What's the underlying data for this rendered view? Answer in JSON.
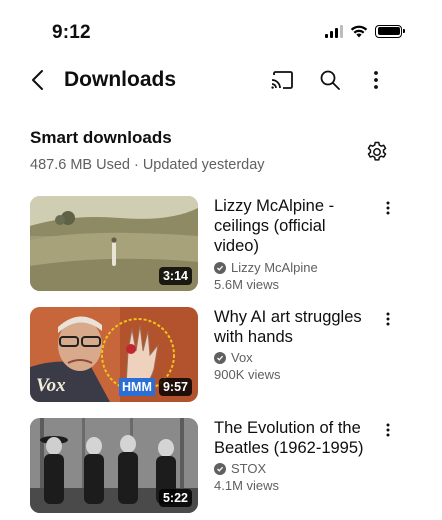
{
  "status_bar": {
    "time": "9:12"
  },
  "header": {
    "title": "Downloads",
    "icons": [
      "back-arrow-icon",
      "cast-icon",
      "search-icon",
      "more-vertical-icon"
    ]
  },
  "smart_downloads": {
    "title": "Smart downloads",
    "subtitle": "487.6 MB Used · Updated yesterday",
    "settings_icon": "gear-icon"
  },
  "videos": [
    {
      "title": "Lizzy McAlpine - ceilings (official video)",
      "channel": "Lizzy McAlpine",
      "views": "5.6M views",
      "duration": "3:14"
    },
    {
      "title": "Why AI art struggles with hands",
      "channel": "Vox",
      "views": "900K views",
      "duration": "9:57",
      "thumb_text": {
        "logo": "Vox",
        "tag": "HMM"
      }
    },
    {
      "title": "The Evolution of the Beatles (1962-1995)",
      "channel": "STOX",
      "views": "4.1M views",
      "duration": "5:22"
    }
  ],
  "colors": {
    "text_primary": "#0f0f0f",
    "text_secondary": "#606060",
    "background": "#ffffff",
    "thumb_tag_blue": "#2b6fd6"
  }
}
